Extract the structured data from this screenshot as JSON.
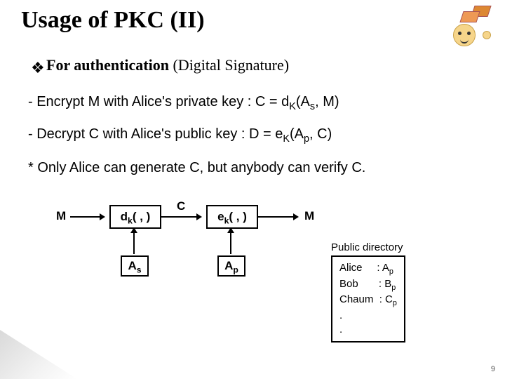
{
  "title": "Usage of PKC  (II)",
  "subtitle_lead": "For authentication",
  "subtitle_rest": " (Digital Signature)",
  "line1_a": "-  Encrypt M with Alice's private key  : C = d",
  "line1_sub": "K",
  "line1_b": "(A",
  "line1_sub2": "s",
  "line1_c": ", M)",
  "line2_a": "-  Decrypt C with  Alice's public key   : D = e",
  "line2_sub": "K",
  "line2_b": "(A",
  "line2_sub2": "p",
  "line2_c": ", C)",
  "line3": "* Only Alice can generate C, but  anybody can verify C.",
  "dia": {
    "M1": "M",
    "box1_a": "d",
    "box1_sub": "k",
    "box1_b": "( , )",
    "C": "C",
    "box2_a": "e",
    "box2_sub": "k",
    "box2_b": "( , )",
    "M2": "M",
    "As_a": "A",
    "As_sub": "s",
    "Ap_a": "A",
    "Ap_sub": "p"
  },
  "dir": {
    "label": "Public directory",
    "row1": "Alice     : A",
    "row1_sub": "p",
    "row2": "Bob       : B",
    "row2_sub": "p",
    "row3": "Chaum  : C",
    "row3_sub": "p",
    "row4": ".",
    "row5": "."
  },
  "page": "9"
}
